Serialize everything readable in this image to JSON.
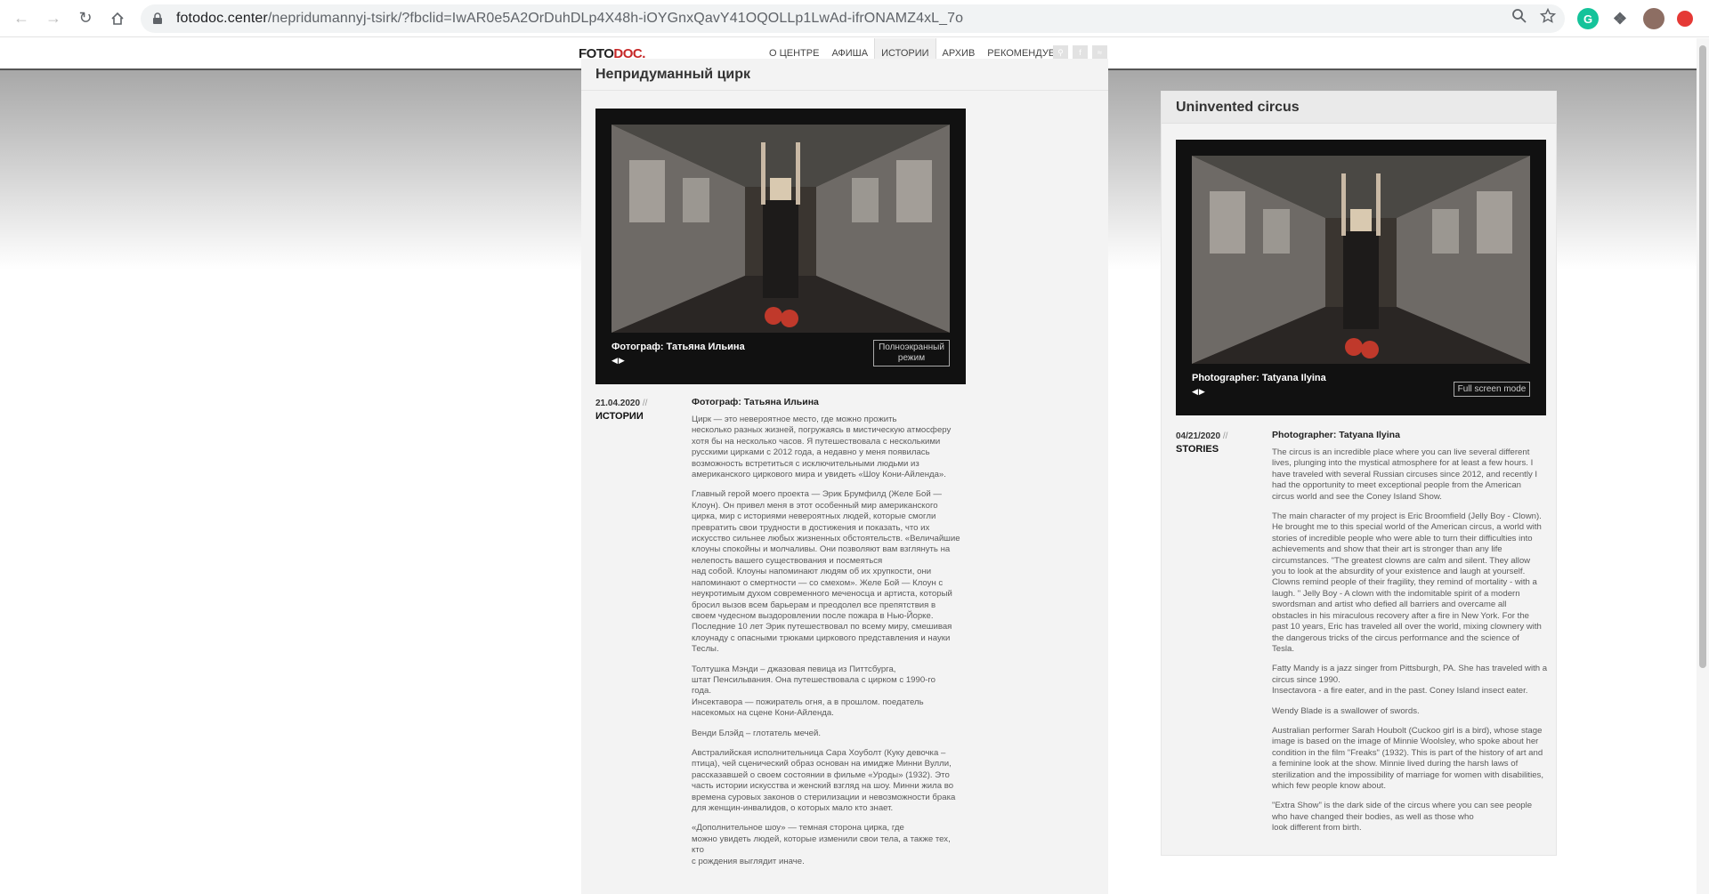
{
  "browser": {
    "url_domain": "fotodoc.center",
    "url_path": "/nepridumannyj-tsirk/?fbclid=IwAR0e5A2OrDuhDLp4X48h-iOYGnxQavY41OQOLLp1LwAd-ifrONAMZ4xL_7o"
  },
  "site": {
    "logo_part1": "FOTO",
    "logo_part2": "DOC.",
    "menu": [
      "О ЦЕНТРЕ",
      "АФИША",
      "ИСТОРИИ",
      "АРХИВ",
      "РЕКОМЕНДУЕМ"
    ],
    "active_menu": "ИСТОРИИ"
  },
  "ru": {
    "title": "Непридуманный цирк",
    "caption": "Фотограф: Татьяна Ильина",
    "fullscreen_label": "Полноэкранный режим",
    "date": "21.04.2020",
    "date_sep": "//",
    "category": "ИСТОРИИ",
    "article_heading": "Фотограф: Татьяна Ильина",
    "paragraphs": [
      "Цирк — это невероятное место, где можно прожить\nнесколько разных жизней, погружаясь в мистическую атмосферу\nхотя бы на несколько часов. Я путешествовала с несколькими\nрусскими цирками с 2012 года, а недавно у меня появилась\nвозможность встретиться с исключительными людьми из\nамериканского циркового мира и увидеть «Шоу Кони-Айленда».",
      "Главный герой моего проекта — Эрик Брумфилд (Желе Бой —\nКлоун). Он привел меня в этот особенный мир американского\nцирка, мир с историями невероятных людей, которые смогли\nпревратить свои трудности в достижения и показать, что их\nискусство сильнее любых жизненных обстоятельств. «Величайшие\nклоуны спокойны и молчаливы. Они позволяют вам взглянуть на\nнелепость вашего существования и посмеяться\nнад собой. Клоуны напоминают людям об их хрупкости, они\nнапоминают о смертности — со смехом». Желе Бой — Клоун с\nнеукротимым духом современного меченосца и артиста, который\nбросил вызов всем барьерам и преодолел все препятствия в\nсвоем чудесном выздоровлении после пожара в Нью-Йорке.\nПоследние 10 лет Эрик путешествовал по всему миру, смешивая\nклоунаду с опасными трюками циркового представления и науки\nТеслы.",
      "Толтушка Мэнди – джазовая певица из Питтсбурга,\nштат Пенсильвания. Она путешествовала с цирком с 1990-го\nгода.\nИнсектавора — пожиратель огня, а в прошлом. поедатель\nнасекомых на сцене Кони-Айленда.",
      "Венди Блэйд – глотатель мечей.",
      "Австралийская исполнительница Сара Хоуболт (Куку девочка –\n птица), чей сценический образ основан на имидже Минни Вулли,\nрассказавшей о своем состоянии в фильме «Уроды» (1932). Это\nчасть истории искусства и женский взгляд на шоу. Минни жила во\nвремена суровых законов о стерилизации и невозможности брака\nдля женщин-инвалидов, о которых мало кто знает.",
      "«Дополнительное шоу» —  темная сторона цирка, где\nможно увидеть людей, которые изменили свои тела, а также тех,\nкто\nс рождения выглядит иначе."
    ]
  },
  "en": {
    "title": "Uninvented circus",
    "caption": "Photographer: Tatyana Ilyina",
    "fullscreen_label": "Full screen mode",
    "date": "04/21/2020",
    "date_sep": "//",
    "category": "STORIES",
    "article_heading": "Photographer: Tatyana Ilyina",
    "paragraphs": [
      "The circus is an incredible place where you can live several different\nlives, plunging into the mystical atmosphere for at least a few hours. I\nhave traveled with several Russian circuses since 2012, and recently I\nhad the opportunity to meet exceptional people from the American\ncircus world and see the Coney Island Show.",
      "The main character of my project is Eric Broomfield (Jelly Boy - Clown).\nHe brought me to this special world of the American circus, a world with\nstories of incredible people who were able to turn their difficulties into\nachievements and show that their art is stronger than any life\ncircumstances. \"The greatest clowns are calm and silent. They allow\nyou to look at the absurdity of your existence and laugh at yourself.\nClowns remind people of their fragility, they remind of mortality - with a\nlaugh. \" Jelly Boy - A clown with the indomitable spirit of a modern\nswordsman and artist who defied all barriers and overcame all\nobstacles in his miraculous recovery after a fire in New York. For the\npast 10 years, Eric has traveled all over the world, mixing clownery with\nthe dangerous tricks of the circus performance and the science of\nTesla.",
      "Fatty Mandy is a jazz singer from Pittsburgh, PA. She has traveled with a\ncircus since 1990.\nInsectavora - a fire eater, and in the past. Coney Island insect eater.",
      "Wendy Blade is a swallower of swords.",
      "Australian performer Sarah Houbolt (Cuckoo girl is a bird), whose stage\nimage is based on the image of Minnie Woolsley, who spoke about her\ncondition in the film \"Freaks\" (1932). This is part of the history of art and\na feminine look at the show. Minnie lived during the harsh laws of\nsterilization and the impossibility of marriage for women with disabilities,\nwhich few people know about.",
      "\"Extra Show\" is the dark side of the circus where you can see people\nwho have changed their bodies, as well as those who\nlook different from birth."
    ]
  }
}
